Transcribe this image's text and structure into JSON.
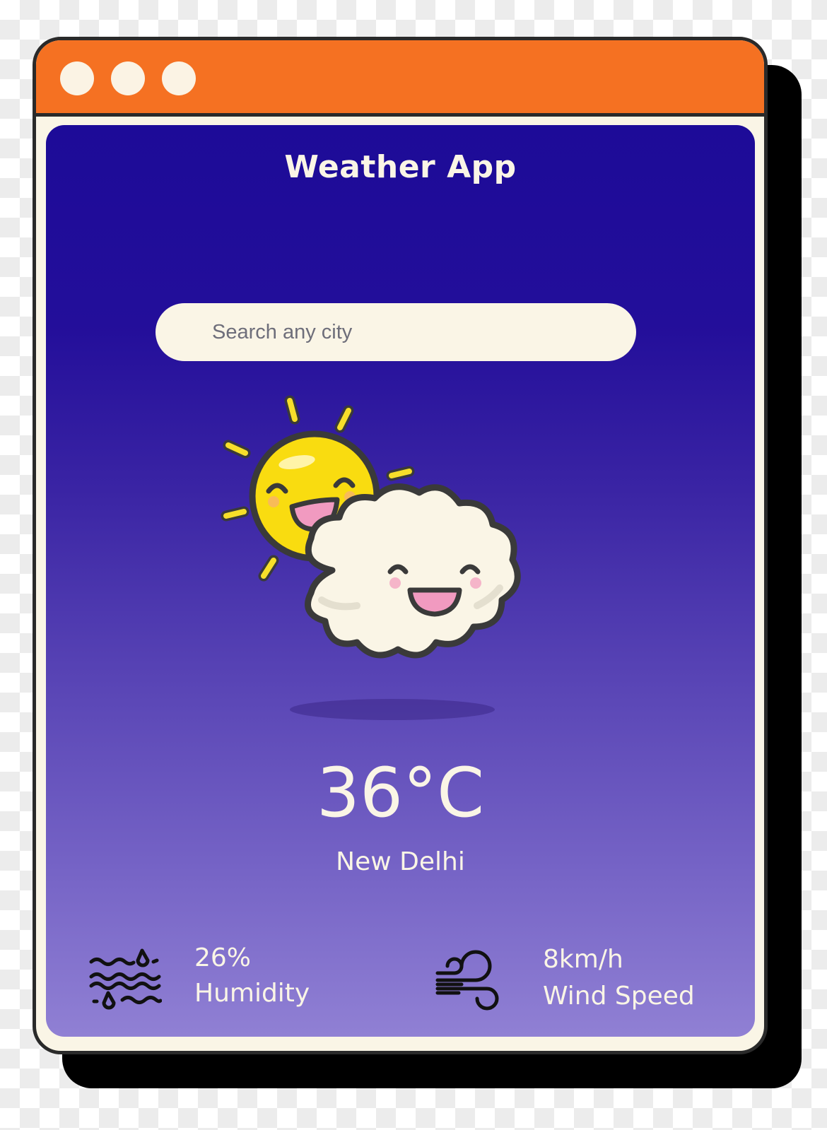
{
  "window": {
    "controls": [
      "close",
      "minimize",
      "maximize"
    ],
    "titlebar_color": "#f57122"
  },
  "app": {
    "title": "Weather App",
    "gradient_top": "#1d0b98",
    "gradient_bottom": "#9080d4"
  },
  "search": {
    "placeholder": "Search any city",
    "value": ""
  },
  "weather": {
    "icon": "sun-behind-cloud-icon",
    "temperature": "36°C",
    "city": "New Delhi"
  },
  "stats": {
    "humidity": {
      "icon": "humidity-icon",
      "value": "26%",
      "label": "Humidity"
    },
    "wind": {
      "icon": "wind-icon",
      "value": "8km/h",
      "label": "Wind Speed"
    }
  }
}
